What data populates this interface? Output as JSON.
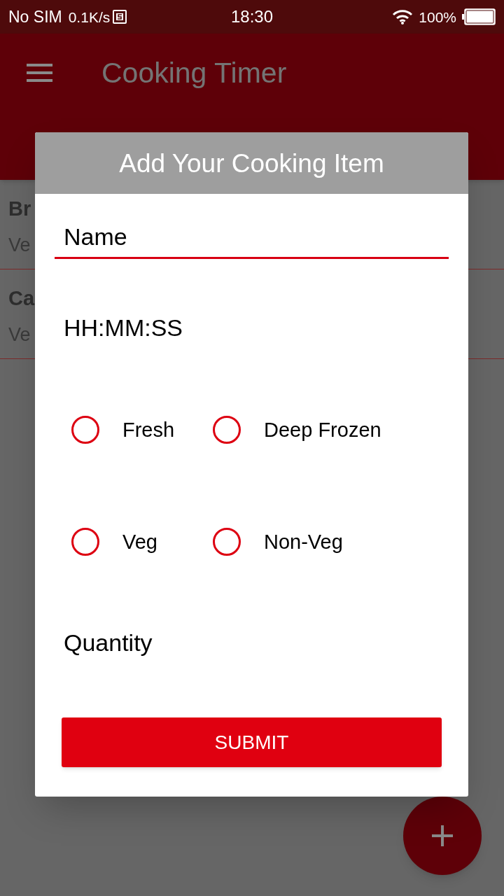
{
  "status_bar": {
    "carrier": "No SIM",
    "speed": "0.1K/s",
    "time": "18:30",
    "battery": "100%"
  },
  "app_bar": {
    "title": "Cooking Timer"
  },
  "list": [
    {
      "title": "Br",
      "subtitle": "Ve"
    },
    {
      "title": "Ca",
      "subtitle": "Ve"
    }
  ],
  "dialog": {
    "title": "Add Your Cooking Item",
    "name_field": {
      "placeholder": "Name",
      "focused": true
    },
    "time_field": {
      "placeholder": "HH:MM:SS",
      "focused": false
    },
    "radio_rows": [
      {
        "options": [
          {
            "label": "Fresh",
            "selected": false
          },
          {
            "label": "Deep Frozen",
            "selected": false
          }
        ]
      },
      {
        "options": [
          {
            "label": "Veg",
            "selected": false
          },
          {
            "label": "Non-Veg",
            "selected": false
          }
        ]
      }
    ],
    "quantity_field": {
      "placeholder": "Quantity",
      "focused": false
    },
    "submit": "SUBMIT"
  }
}
